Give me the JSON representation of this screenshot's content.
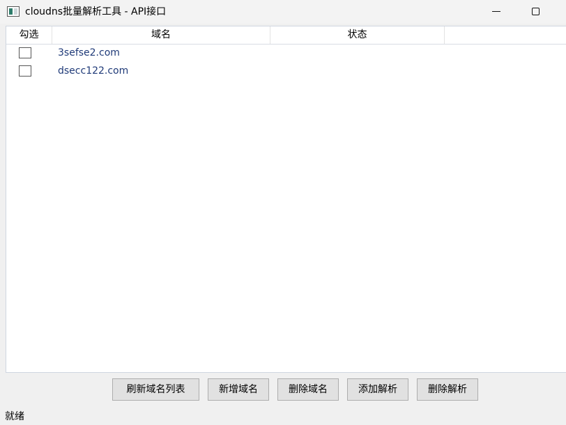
{
  "window": {
    "title": "cloudns批量解析工具 - API接口",
    "icon": "app-icon"
  },
  "table": {
    "columns": [
      "勾选",
      "域名",
      "状态",
      ""
    ],
    "rows": [
      {
        "checked": false,
        "domain": "3sefse2.com",
        "status": ""
      },
      {
        "checked": false,
        "domain": "dsecc122.com",
        "status": ""
      }
    ]
  },
  "buttons": {
    "refresh": "刷新域名列表",
    "add_domain": "新增域名",
    "delete_domain": "删除域名",
    "add_record": "添加解析",
    "delete_record": "删除解析"
  },
  "statusbar": {
    "text": "就绪"
  },
  "colors": {
    "domain_text": "#1f3a78",
    "button_bg": "#e1e1e1"
  }
}
